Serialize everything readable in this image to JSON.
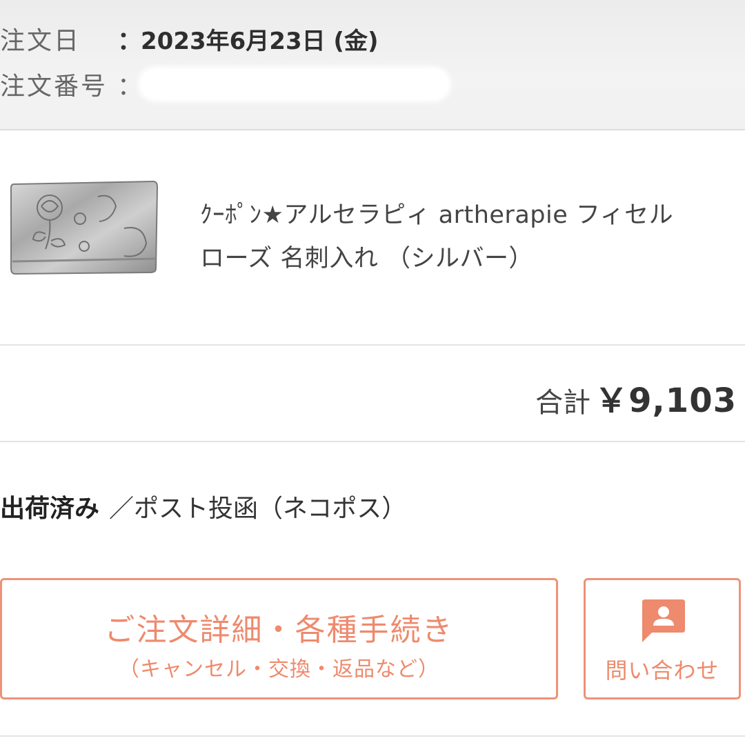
{
  "order": {
    "date_label": "注文日",
    "date_colon": "：",
    "date_value": "2023年6月23日 (金)",
    "number_label": "注文番号",
    "number_colon": "："
  },
  "product": {
    "name_line1": "ｸｰﾎﾟﾝ★アルセラピィ artherapie フィセル",
    "name_line2": "ローズ 名刺入れ （シルバー）"
  },
  "total": {
    "label": "合計",
    "value": "￥9,103"
  },
  "shipping": {
    "status": "出荷済み",
    "method": "／ポスト投函（ネコポス）"
  },
  "actions": {
    "details_title": "ご注文詳細・各種手続き",
    "details_subtitle": "（キャンセル・交換・返品など）",
    "inquiry_label": "問い合わせ",
    "inquiry_icon": "chat-person-icon"
  },
  "colors": {
    "accent": "#ee8a6d",
    "header_bg": "#efefef",
    "divider": "#e4e4e4"
  }
}
